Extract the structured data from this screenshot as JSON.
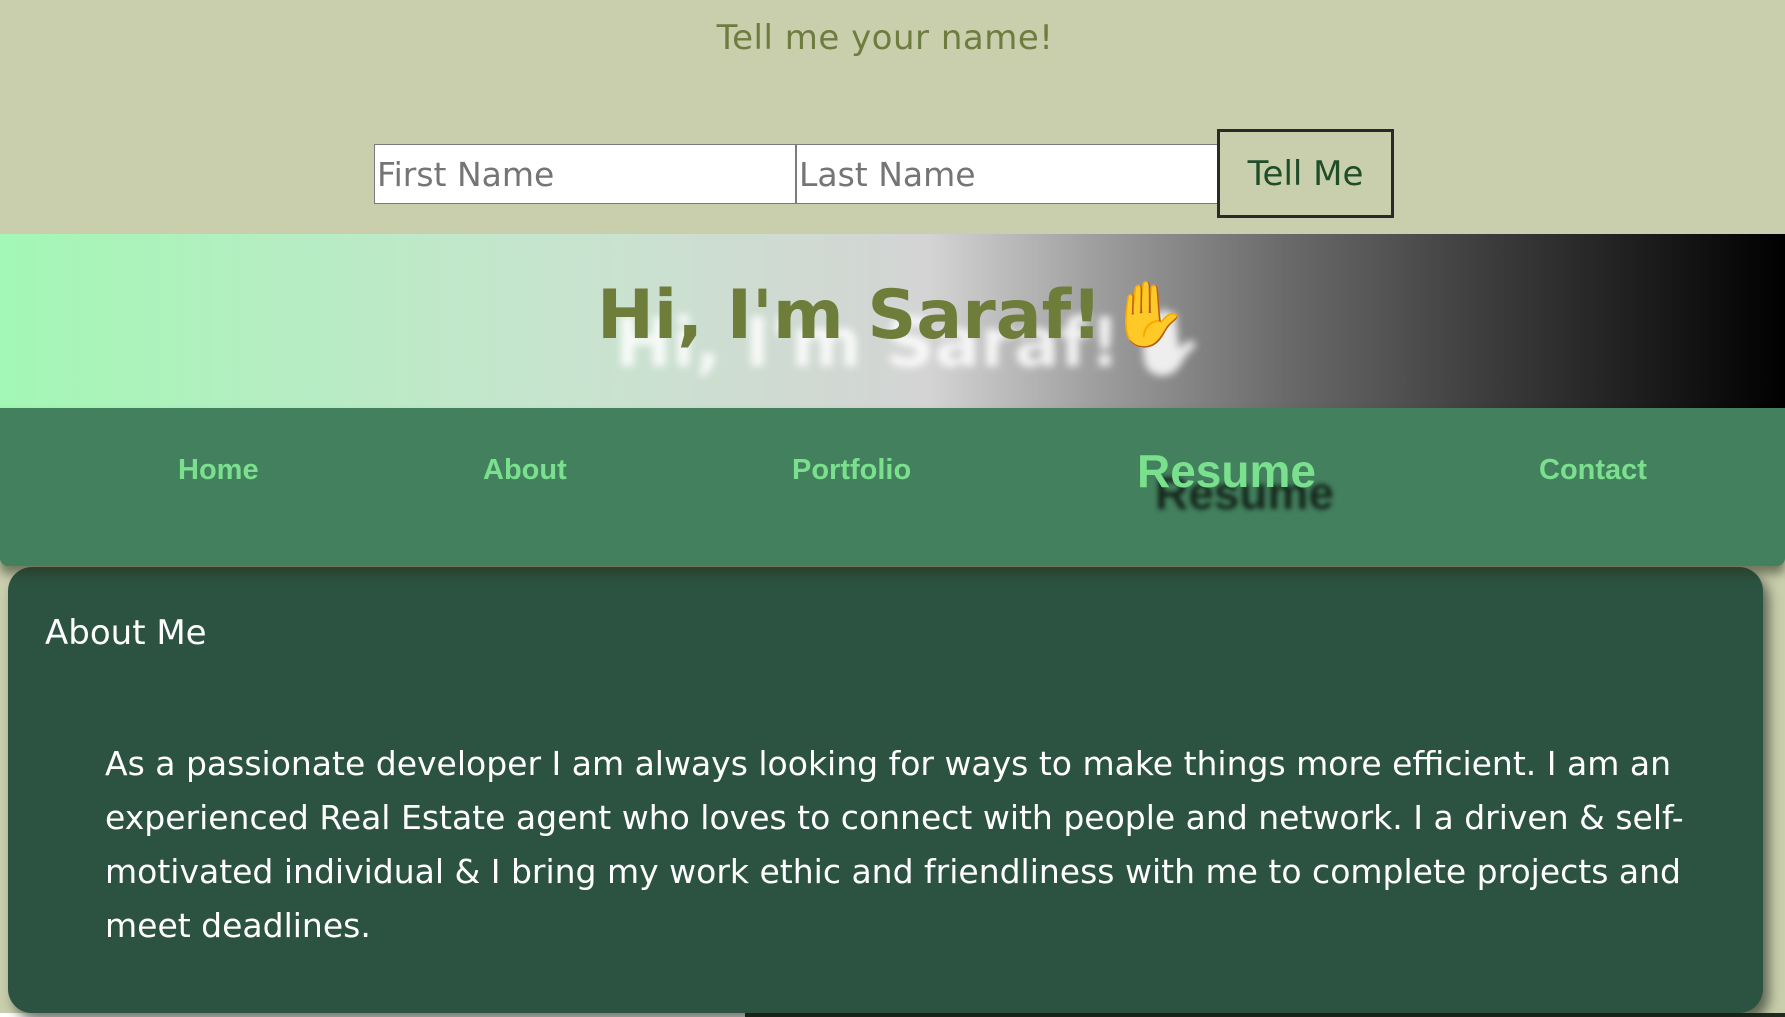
{
  "form": {
    "prompt": "Tell me your name!",
    "first_name_placeholder": "First Name",
    "first_name_value": "",
    "last_name_placeholder": "Last Name",
    "last_name_value": "",
    "submit_label": "Tell Me"
  },
  "hero": {
    "title": "Hi, I'm Saraf!",
    "emoji": "✋",
    "emoji_icon": "raised-hand-icon"
  },
  "nav": {
    "items": [
      {
        "label": "Home"
      },
      {
        "label": "About"
      },
      {
        "label": "Portfolio"
      },
      {
        "label": "Resume"
      },
      {
        "label": "Contact"
      }
    ],
    "active": "Resume"
  },
  "about": {
    "heading": "About Me",
    "body": "As a passionate developer I am always looking for ways to make things more efficient. I am an experienced Real Estate agent who loves to connect with people and network. I a driven & self-motivated individual & I bring my work ethic and friendliness with me to complete projects and meet deadlines."
  },
  "colors": {
    "page_background": "#c9cfad",
    "nav_background": "#43805e",
    "nav_link": "#7be08e",
    "card_background": "#2c5341",
    "title_color": "#6e7d3a"
  }
}
